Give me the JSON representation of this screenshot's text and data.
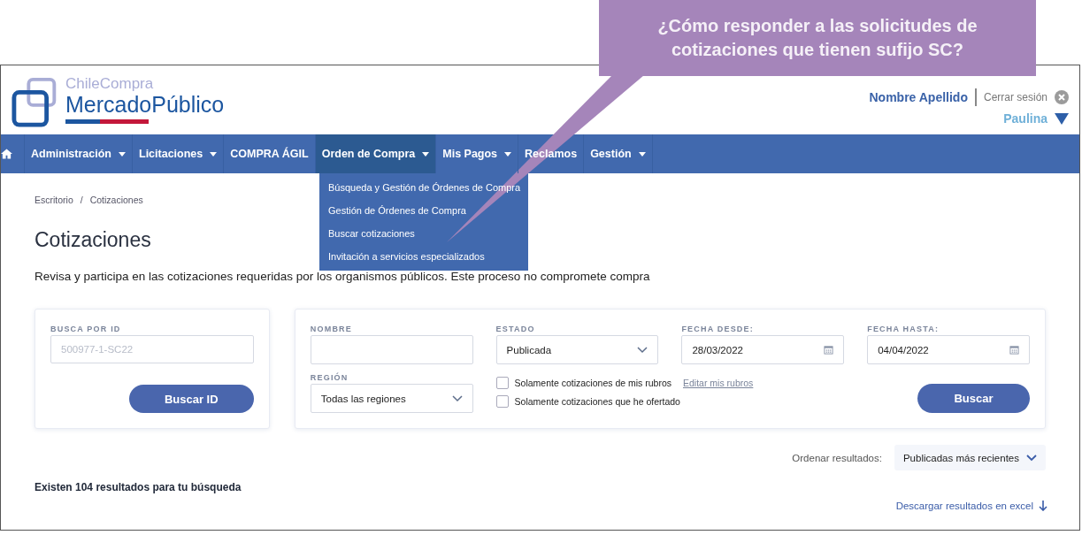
{
  "callout": {
    "lines": [
      "¿Cómo responder a las solicitudes de",
      "cotizaciones que tienen sufijo SC?"
    ]
  },
  "header": {
    "logo_top": "ChileCompra",
    "logo_bottom": "MercadoPúblico",
    "user_name": "Nombre Apellido",
    "logout": "Cerrar sesión",
    "user_menu": "Paulina"
  },
  "nav": {
    "items": [
      {
        "label": "Administración",
        "has_dropdown": true,
        "selected": false
      },
      {
        "label": "Licitaciones",
        "has_dropdown": true,
        "selected": false
      },
      {
        "label": "COMPRA ÁGIL",
        "has_dropdown": false,
        "selected": false
      },
      {
        "label": "Orden de Compra",
        "has_dropdown": true,
        "selected": true
      },
      {
        "label": "Mis Pagos",
        "has_dropdown": true,
        "selected": false
      },
      {
        "label": "Reclamos",
        "has_dropdown": false,
        "selected": false
      },
      {
        "label": "Gestión",
        "has_dropdown": true,
        "selected": false
      }
    ],
    "dropdown": [
      "Búsqueda y Gestión de Órdenes de Compra",
      "Gestión de Órdenes de Compra",
      "Buscar cotizaciones",
      "Invitación a servicios especializados"
    ]
  },
  "breadcrumb": {
    "items": [
      "Escritorio",
      "Cotizaciones"
    ],
    "separator": "/"
  },
  "title": "Cotizaciones",
  "description": "Revisa y participa en las cotizaciones requeridas por los organismos públicos. Este proceso no compromete compra",
  "id_search": {
    "label": "BUSCA POR ID",
    "placeholder": "500977-1-SC22",
    "button": "Buscar ID"
  },
  "filters": {
    "fields": [
      {
        "label": "NOMBRE",
        "kind": "text"
      },
      {
        "label": "ESTADO",
        "kind": "select",
        "value": "Publicada"
      },
      {
        "label": "FECHA DESDE:",
        "kind": "date",
        "value": "28/03/2022"
      },
      {
        "label": "FECHA HASTA:",
        "kind": "date",
        "value": "04/04/2022"
      },
      {
        "label": "REGIÓN",
        "kind": "select",
        "value": "Todas las regiones"
      }
    ],
    "checkboxes": [
      {
        "label": "Solamente cotizaciones de mis rubros",
        "checked": false,
        "link": "Editar mis rubros"
      },
      {
        "label": "Solamente cotizaciones que he ofertado",
        "checked": false
      }
    ],
    "button": "Buscar"
  },
  "sort": {
    "label": "Ordenar resultados:",
    "value": "Publicadas más recientes"
  },
  "results_count": "Existen 104 resultados para tu búsqueda",
  "download": "Descargar resultados en excel"
}
